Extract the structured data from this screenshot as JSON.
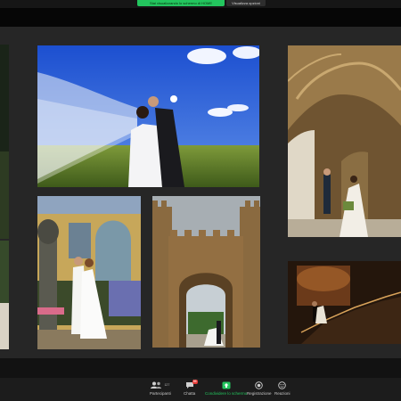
{
  "banner": {
    "share_status": "Stai visualizzando lo schermo di HOME",
    "view_options": "Visualizza opzioni"
  },
  "toolbar": {
    "participants": {
      "label": "Partecipanti",
      "count": "127",
      "icon": "participants-icon"
    },
    "chat": {
      "label": "Chatta",
      "badge": "56",
      "icon": "chat-icon"
    },
    "share": {
      "label": "Condividere lo schermo",
      "icon": "share-screen-icon",
      "color": "#23c55e"
    },
    "record": {
      "label": "Registrazione",
      "icon": "record-icon"
    },
    "reactions": {
      "label": "Reazioni",
      "icon": "reactions-icon"
    }
  },
  "colors": {
    "accent_green": "#23c55e",
    "slide_background": "#262626",
    "toolbar_background": "#1c1c1c"
  }
}
